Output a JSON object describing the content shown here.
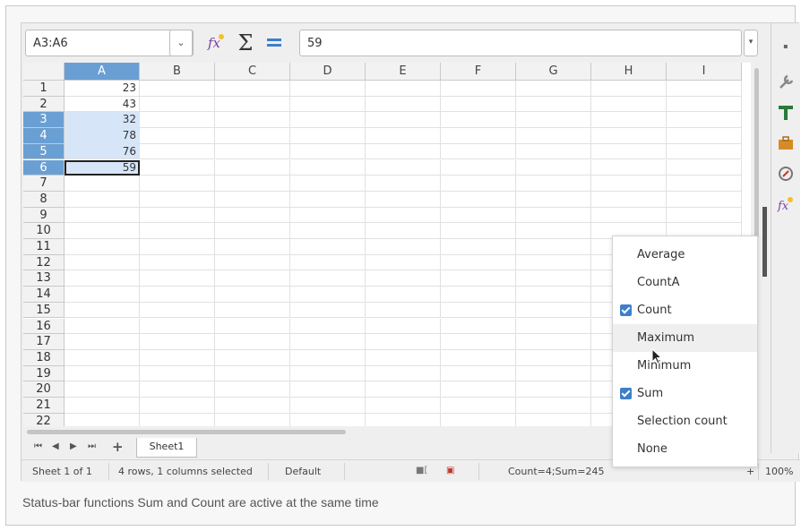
{
  "formula_bar": {
    "name_box_value": "A3:A6",
    "formula_value": "59",
    "icons": [
      "function-wizard-icon",
      "sum-icon",
      "formula-icon"
    ]
  },
  "columns": [
    "A",
    "B",
    "C",
    "D",
    "E",
    "F",
    "G",
    "H",
    "I"
  ],
  "rows": [
    "1",
    "2",
    "3",
    "4",
    "5",
    "6",
    "7",
    "8",
    "9",
    "10",
    "11",
    "12",
    "13",
    "14",
    "15",
    "16",
    "17",
    "18",
    "19",
    "20",
    "21",
    "22"
  ],
  "column_a_values": [
    "23",
    "43",
    "32",
    "78",
    "76",
    "59"
  ],
  "sheet_tabs": {
    "active": "Sheet1"
  },
  "status_bar": {
    "sheet_position": "Sheet 1 of 1",
    "selection_info": "4 rows, 1 columns selected",
    "page_style": "Default",
    "functions_result": "Count=4;Sum=245",
    "zoom": "100%"
  },
  "context_menu": {
    "items": [
      {
        "label": "Average",
        "checked": false
      },
      {
        "label": "CountA",
        "checked": false
      },
      {
        "label": "Count",
        "checked": true
      },
      {
        "label": "Maximum",
        "checked": false
      },
      {
        "label": "Minimum",
        "checked": false
      },
      {
        "label": "Sum",
        "checked": true
      },
      {
        "label": "Selection count",
        "checked": false
      },
      {
        "label": "None",
        "checked": false
      }
    ]
  },
  "caption": "Status-bar functions Sum and Count are active at the same time",
  "colors": {
    "selection_header": "#6a9fd4",
    "selection_cell": "#d6e6f8",
    "checkbox": "#3d7fcb"
  }
}
